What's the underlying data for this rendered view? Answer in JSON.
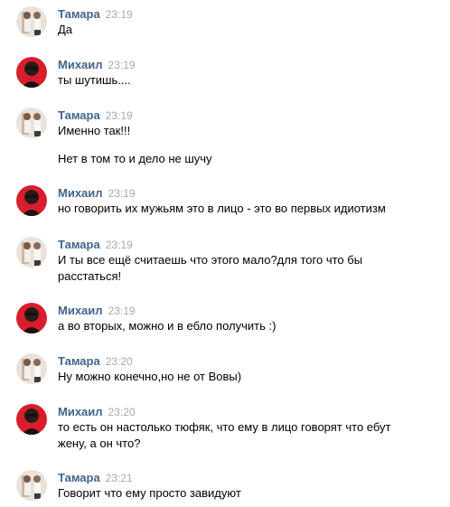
{
  "users": {
    "tamara": "Тамара",
    "mikhail": "Михаил"
  },
  "avatars": {
    "tamara": "avatar-photo-light",
    "mikhail": "avatar-photo-red"
  },
  "colors": {
    "name": "#42648b",
    "time": "#a4a9b0",
    "text": "#000000",
    "mikhail_avatar": "#d81e2c"
  },
  "messages": [
    {
      "author": "Тамара",
      "time": "23:19",
      "lines": [
        "Да"
      ]
    },
    {
      "author": "Михаил",
      "time": "23:19",
      "lines": [
        "ты шутишь...."
      ]
    },
    {
      "author": "Тамара",
      "time": "23:19",
      "lines": [
        "Именно так!!!",
        "Нет в том то и дело не шучу"
      ]
    },
    {
      "author": "Михаил",
      "time": "23:19",
      "lines": [
        "но говорить их мужьям это в лицо - это во первых идиотизм"
      ]
    },
    {
      "author": "Тамара",
      "time": "23:19",
      "lines": [
        "И ты все ещё считаешь что этого мало?для того что бы",
        "расстаться!"
      ]
    },
    {
      "author": "Михаил",
      "time": "23:19",
      "lines": [
        "а во вторых, можно и в ебло получить :)"
      ]
    },
    {
      "author": "Тамара",
      "time": "23:20",
      "lines": [
        "Ну можно конечно,но не от Вовы)"
      ]
    },
    {
      "author": "Михаил",
      "time": "23:20",
      "lines": [
        "то есть он настолько тюфяк, что ему в лицо говорят что ебут",
        "жену, а он что?"
      ]
    },
    {
      "author": "Тамара",
      "time": "23:21",
      "lines": [
        "Говорит что ему просто завидуют"
      ]
    }
  ]
}
